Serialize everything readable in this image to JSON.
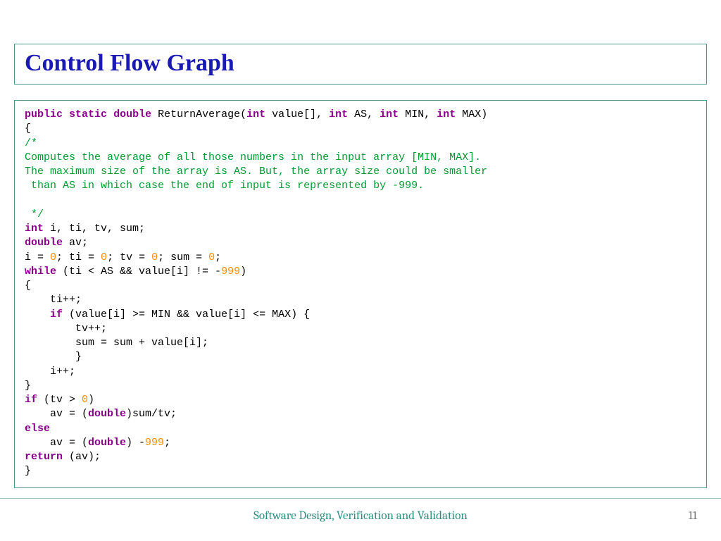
{
  "slide": {
    "title": "Control Flow Graph",
    "footer": "Software Design,  Verification and Validation",
    "page": "11"
  },
  "code": {
    "sig": {
      "public": "public",
      "static": "static",
      "double": "double",
      "name": " ReturnAverage(",
      "int1": "int",
      "p1": " value[], ",
      "int2": "int",
      "p2": " AS, ",
      "int3": "int",
      "p3": " MIN, ",
      "int4": "int",
      "p4": " MAX)"
    },
    "brace_open": "{",
    "cm1": "/*",
    "cm2": "Computes the average of all those numbers in the input array [MIN, MAX].",
    "cm3": "The maximum size of the array is AS. But, the array size could be smaller",
    "cm4": " than AS in which case the end of input is represented by -999.",
    "cm5": " */",
    "decl1": {
      "kw": "int",
      "rest": " i, ti, tv, sum;"
    },
    "decl2": {
      "kw": "double",
      "rest": " av;"
    },
    "init": {
      "a": "i = ",
      "z1": "0",
      "b": "; ti = ",
      "z2": "0",
      "c": "; tv = ",
      "z3": "0",
      "d": "; sum = ",
      "z4": "0",
      "e": ";"
    },
    "while": {
      "kw": "while",
      "cond": " (ti < AS && value[i] != -",
      "n": "999",
      "tail": ")"
    },
    "wbrace": "{",
    "tipp": "    ti++;",
    "if1": {
      "pad": "    ",
      "kw": "if",
      "rest": " (value[i] >= MIN && value[i] <= MAX) {"
    },
    "tvpp": "        tv++;",
    "sumline": "        sum = sum + value[i];",
    "if1close": "        }",
    "ipp": "    i++;",
    "wbrace_close": "}",
    "if2": {
      "kw": "if",
      "cond": " (tv > ",
      "n": "0",
      "tail": ")"
    },
    "avline": {
      "pad": "    av = (",
      "kw": "double",
      "rest": ")sum/tv;"
    },
    "else": "else",
    "avline2": {
      "pad": "    av = (",
      "kw": "double",
      "mid": ") -",
      "n": "999",
      "tail": ";"
    },
    "ret": {
      "kw": "return",
      "rest": " (av);"
    },
    "brace_close": "}"
  }
}
